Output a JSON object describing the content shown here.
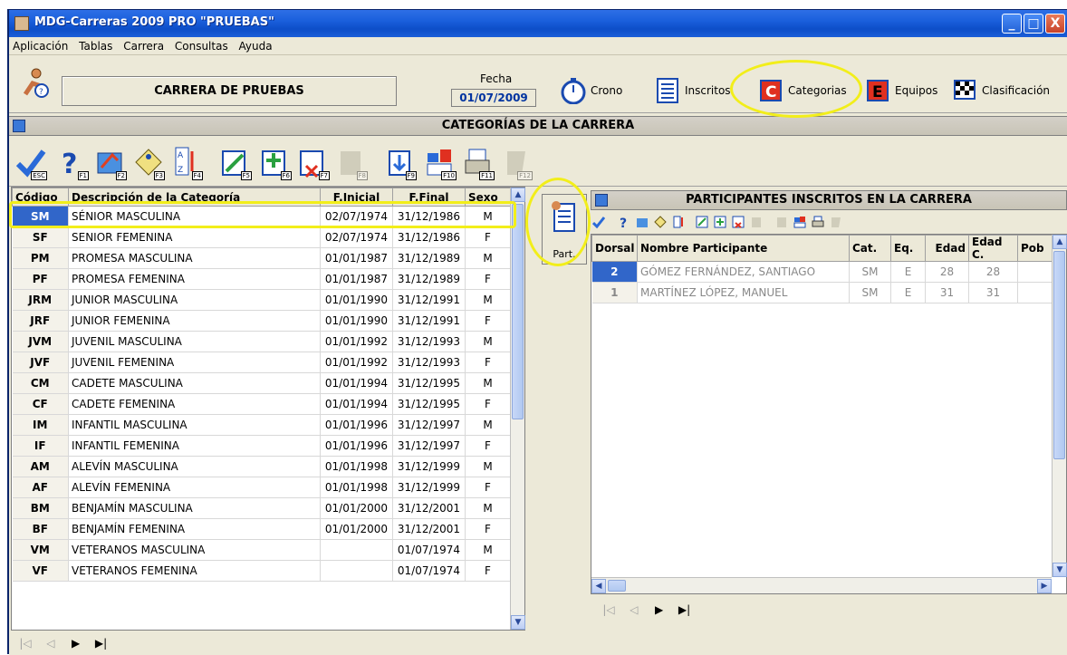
{
  "window": {
    "title": "MDG-Carreras 2009 PRO \"PRUEBAS\"",
    "min_label": "_",
    "max_label": "□",
    "close_label": "X"
  },
  "menu": [
    "Aplicación",
    "Tablas",
    "Carrera",
    "Consultas",
    "Ayuda"
  ],
  "header": {
    "race_name": "CARRERA DE PRUEBAS",
    "fecha_label": "Fecha",
    "fecha_value": "01/07/2009",
    "buttons": {
      "crono": "Crono",
      "inscritos": "Inscritos",
      "categorias": "Categorias",
      "equipos": "Equipos",
      "clasificacion": "Clasificación"
    }
  },
  "categories_section": {
    "title": "CATEGORÍAS DE LA CARRERA",
    "fkeys": [
      "ESC",
      "F1",
      "F2",
      "F3",
      "F4",
      "F5",
      "F6",
      "F7",
      "F8",
      "F9",
      "F10",
      "F11",
      "F12"
    ],
    "columns": [
      "Código",
      "Descripción de la Categoría",
      "F.Inicial",
      "F.Final",
      "Sexo"
    ],
    "rows": [
      {
        "code": "SM",
        "desc": "SÉNIOR MASCULINA",
        "ini": "02/07/1974",
        "fin": "31/12/1986",
        "sexo": "M"
      },
      {
        "code": "SF",
        "desc": "SENIOR FEMENINA",
        "ini": "02/07/1974",
        "fin": "31/12/1986",
        "sexo": "F"
      },
      {
        "code": "PM",
        "desc": "PROMESA MASCULINA",
        "ini": "01/01/1987",
        "fin": "31/12/1989",
        "sexo": "M"
      },
      {
        "code": "PF",
        "desc": "PROMESA FEMENINA",
        "ini": "01/01/1987",
        "fin": "31/12/1989",
        "sexo": "F"
      },
      {
        "code": "JRM",
        "desc": "JUNIOR MASCULINA",
        "ini": "01/01/1990",
        "fin": "31/12/1991",
        "sexo": "M"
      },
      {
        "code": "JRF",
        "desc": "JUNIOR FEMENINA",
        "ini": "01/01/1990",
        "fin": "31/12/1991",
        "sexo": "F"
      },
      {
        "code": "JVM",
        "desc": "JUVENIL MASCULINA",
        "ini": "01/01/1992",
        "fin": "31/12/1993",
        "sexo": "M"
      },
      {
        "code": "JVF",
        "desc": "JUVENIL FEMENINA",
        "ini": "01/01/1992",
        "fin": "31/12/1993",
        "sexo": "F"
      },
      {
        "code": "CM",
        "desc": "CADETE MASCULINA",
        "ini": "01/01/1994",
        "fin": "31/12/1995",
        "sexo": "M"
      },
      {
        "code": "CF",
        "desc": "CADETE FEMENINA",
        "ini": "01/01/1994",
        "fin": "31/12/1995",
        "sexo": "F"
      },
      {
        "code": "IM",
        "desc": "INFANTIL MASCULINA",
        "ini": "01/01/1996",
        "fin": "31/12/1997",
        "sexo": "M"
      },
      {
        "code": "IF",
        "desc": "INFANTIL FEMENINA",
        "ini": "01/01/1996",
        "fin": "31/12/1997",
        "sexo": "F"
      },
      {
        "code": "AM",
        "desc": "ALEVÍN MASCULINA",
        "ini": "01/01/1998",
        "fin": "31/12/1999",
        "sexo": "M"
      },
      {
        "code": "AF",
        "desc": "ALEVÍN FEMENINA",
        "ini": "01/01/1998",
        "fin": "31/12/1999",
        "sexo": "F"
      },
      {
        "code": "BM",
        "desc": "BENJAMÍN MASCULINA",
        "ini": "01/01/2000",
        "fin": "31/12/2001",
        "sexo": "M"
      },
      {
        "code": "BF",
        "desc": "BENJAMÍN FEMENINA",
        "ini": "01/01/2000",
        "fin": "31/12/2001",
        "sexo": "F"
      },
      {
        "code": "VM",
        "desc": "VETERANOS MASCULINA",
        "ini": "",
        "fin": "01/07/1974",
        "sexo": "M"
      },
      {
        "code": "VF",
        "desc": "VETERANOS FEMENINA",
        "ini": "",
        "fin": "01/07/1974",
        "sexo": "F"
      }
    ]
  },
  "participants_section": {
    "title": "PARTICIPANTES INSCRITOS EN LA CARRERA",
    "part_button": "Part.",
    "columns": [
      "Dorsal",
      "Nombre Participante",
      "Cat.",
      "Eq.",
      "Edad",
      "Edad C.",
      "Pob"
    ],
    "rows": [
      {
        "dorsal": "2",
        "nombre": "GÓMEZ FERNÁNDEZ, SANTIAGO",
        "cat": "SM",
        "eq": "E",
        "edad": "28",
        "edadc": "28",
        "pob": ""
      },
      {
        "dorsal": "1",
        "nombre": "MARTÍNEZ LÓPEZ, MANUEL",
        "cat": "SM",
        "eq": "E",
        "edad": "31",
        "edadc": "31",
        "pob": ""
      }
    ]
  },
  "nav": {
    "first": "|◁",
    "prev": "◁",
    "next": "▶",
    "last": "▶|"
  },
  "colors": {
    "title_blue": "#1a5fdc",
    "selection": "#3166c9",
    "highlight": "#f2ee1a"
  }
}
